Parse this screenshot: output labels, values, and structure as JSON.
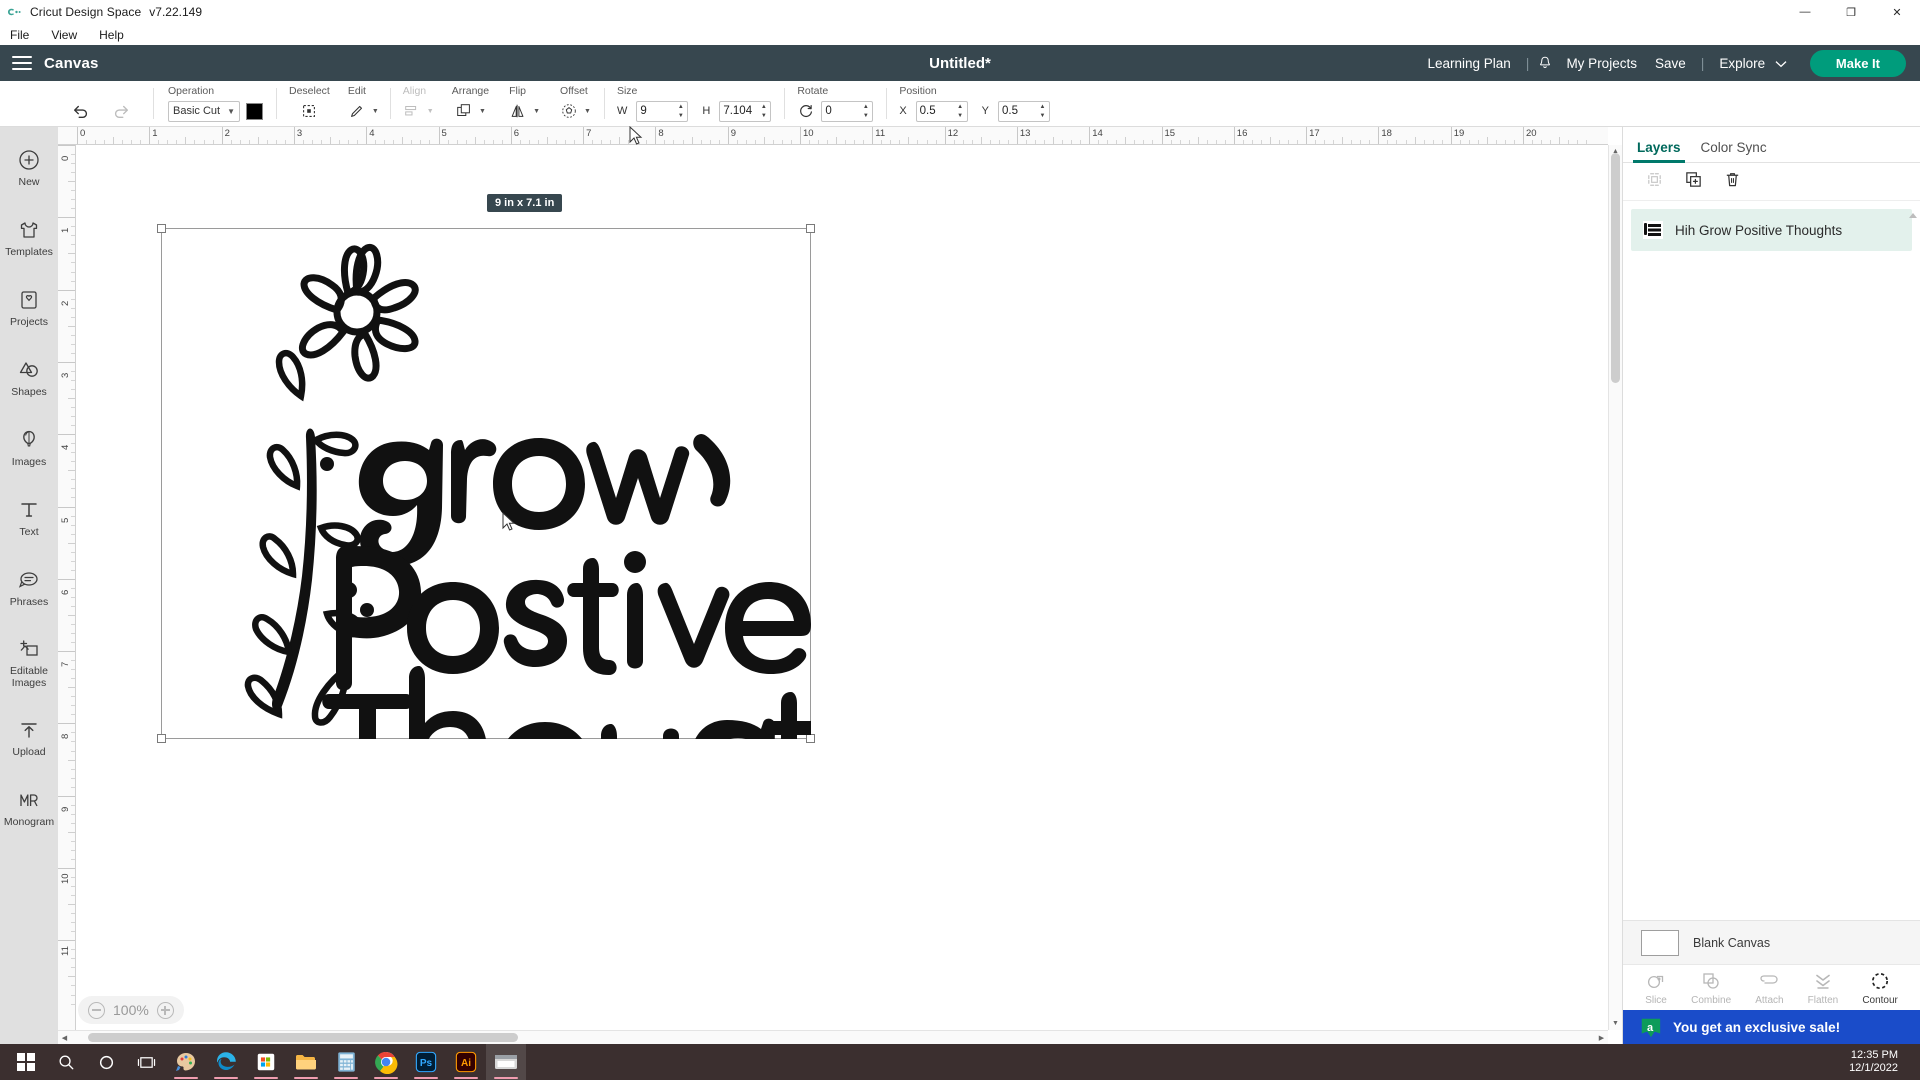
{
  "window": {
    "app_title": "Cricut Design Space",
    "version": "v7.22.149",
    "menu": [
      "File",
      "View",
      "Help"
    ],
    "controls": {
      "minimize": "—",
      "maximize": "❐",
      "close": "✕"
    }
  },
  "header": {
    "canvas_label": "Canvas",
    "document_title": "Untitled*",
    "learning_plan": "Learning Plan",
    "sep1": "|",
    "my_projects": "My Projects",
    "save": "Save",
    "sep2": "|",
    "explore": "Explore",
    "make_it": "Make It",
    "accent_color": "#009c7c",
    "bar_color": "#37474f"
  },
  "toolbar": {
    "operation": {
      "label": "Operation",
      "value": "Basic Cut",
      "color": "#000000"
    },
    "deselect": {
      "label": "Deselect"
    },
    "edit": {
      "label": "Edit"
    },
    "align": {
      "label": "Align",
      "disabled": true
    },
    "arrange": {
      "label": "Arrange"
    },
    "flip": {
      "label": "Flip"
    },
    "offset": {
      "label": "Offset"
    },
    "size": {
      "label": "Size",
      "w_label": "W",
      "w_value": "9",
      "h_label": "H",
      "h_value": "7.104",
      "locked": true
    },
    "rotate": {
      "label": "Rotate",
      "value": "0"
    },
    "position": {
      "label": "Position",
      "x_label": "X",
      "x_value": "0.5",
      "y_label": "Y",
      "y_value": "0.5"
    }
  },
  "sidebar": {
    "items": [
      {
        "label": "New",
        "icon": "plus-circle-icon"
      },
      {
        "label": "Templates",
        "icon": "shirt-icon"
      },
      {
        "label": "Projects",
        "icon": "projects-icon"
      },
      {
        "label": "Shapes",
        "icon": "shapes-icon"
      },
      {
        "label": "Images",
        "icon": "balloon-icon"
      },
      {
        "label": "Text",
        "icon": "text-icon"
      },
      {
        "label": "Phrases",
        "icon": "phrases-icon"
      },
      {
        "label": "Editable Images",
        "icon": "editable-images-icon"
      },
      {
        "label": "Upload",
        "icon": "upload-icon"
      },
      {
        "label": "Monogram",
        "icon": "monogram-icon"
      }
    ]
  },
  "canvas": {
    "zoom_level": "100%",
    "zoom_out_icon": "minus-circle-icon",
    "zoom_in_icon": "plus-circle-icon",
    "selection_size_badge": "9 in x 7.1 in",
    "ruler_top_numbers": [
      "0",
      "1",
      "2",
      "3",
      "4",
      "5",
      "6",
      "7",
      "8",
      "9",
      "10",
      "11",
      "12",
      "13",
      "14",
      "15",
      "16",
      "17",
      "18",
      "19",
      "20"
    ],
    "ruler_left_numbers": [
      "0",
      "1",
      "2",
      "3",
      "4",
      "5",
      "6",
      "7",
      "8",
      "9",
      "10",
      "11"
    ],
    "artwork_text_lines": [
      "grow",
      "Positive",
      "Thoughts"
    ]
  },
  "right_panel": {
    "tabs": [
      {
        "label": "Layers",
        "active": true
      },
      {
        "label": "Color Sync",
        "active": false
      }
    ],
    "tools": [
      {
        "name": "group-icon",
        "disabled": true
      },
      {
        "name": "duplicate-icon",
        "disabled": false
      },
      {
        "name": "delete-icon",
        "disabled": false
      }
    ],
    "layers": [
      {
        "name": "Hih Grow Positive Thoughts",
        "selected": true
      }
    ],
    "canvas_row": {
      "label": "Blank Canvas"
    },
    "operations": [
      {
        "label": "Slice",
        "icon": "slice-icon",
        "disabled": true
      },
      {
        "label": "Combine",
        "icon": "combine-icon",
        "disabled": true
      },
      {
        "label": "Attach",
        "icon": "attach-icon",
        "disabled": true
      },
      {
        "label": "Flatten",
        "icon": "flatten-icon",
        "disabled": true
      },
      {
        "label": "Contour",
        "icon": "contour-icon",
        "disabled": false
      }
    ],
    "banner": {
      "text": "You get an exclusive sale!",
      "badge_letter": "a",
      "bg_color": "#1a4cc9"
    }
  },
  "taskbar": {
    "items": [
      {
        "name": "start-icon"
      },
      {
        "name": "search-icon"
      },
      {
        "name": "cortana-icon"
      },
      {
        "name": "task-view-icon"
      },
      {
        "name": "paint-icon"
      },
      {
        "name": "edge-icon"
      },
      {
        "name": "store-icon"
      },
      {
        "name": "file-explorer-icon"
      },
      {
        "name": "calculator-icon"
      },
      {
        "name": "chrome-icon"
      },
      {
        "name": "photoshop-icon"
      },
      {
        "name": "illustrator-icon"
      },
      {
        "name": "cricut-icon"
      }
    ],
    "time": "12:35 PM",
    "date": "12/1/2022"
  }
}
